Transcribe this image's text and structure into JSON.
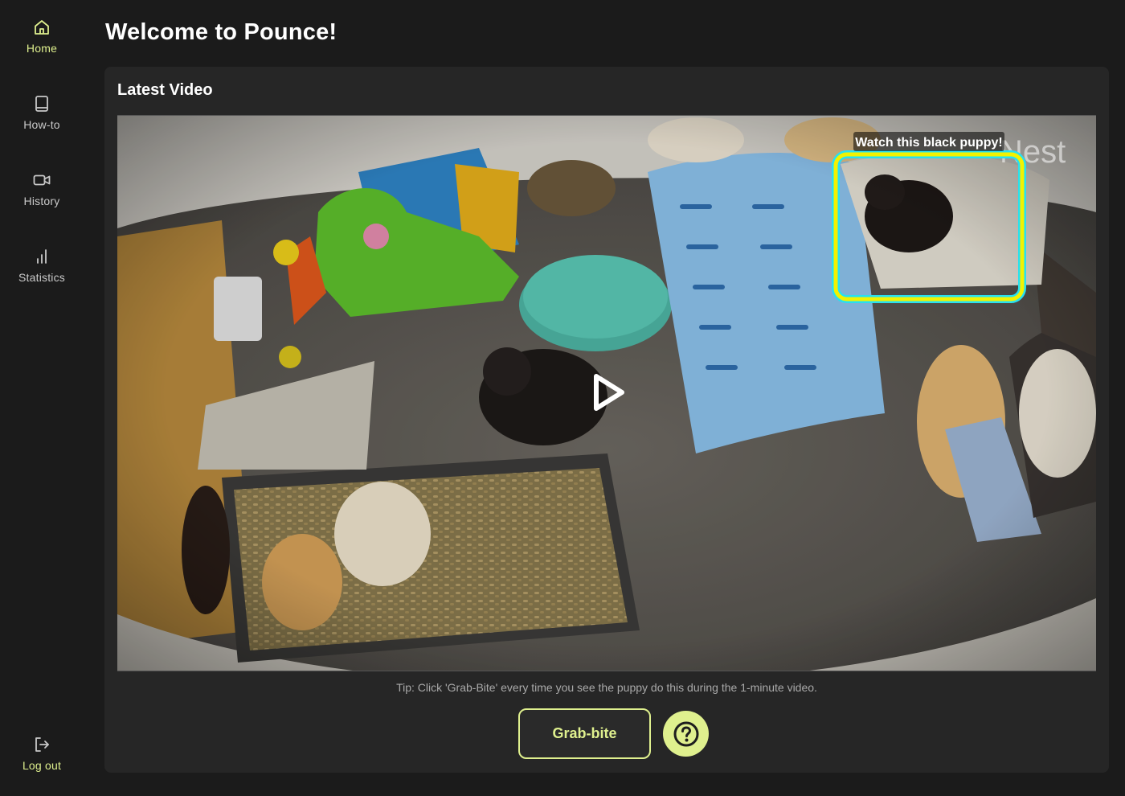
{
  "sidebar": {
    "items": [
      {
        "label": "Home",
        "icon": "home-icon",
        "active": true
      },
      {
        "label": "How-to",
        "icon": "book-icon",
        "active": false
      },
      {
        "label": "History",
        "icon": "video-camera-icon",
        "active": false
      },
      {
        "label": "Statistics",
        "icon": "bar-chart-icon",
        "active": false
      }
    ],
    "logout": {
      "label": "Log out",
      "icon": "logout-icon"
    }
  },
  "header": {
    "title": "Welcome to Pounce!"
  },
  "card": {
    "title": "Latest Video",
    "video": {
      "highlight_caption": "Watch this black puppy!",
      "watermark": "Nest",
      "play_icon": "play-icon"
    },
    "tip": "Tip: Click 'Grab-Bite' every time you see the puppy do this during the 1-minute video.",
    "grab_button_label": "Grab-bite",
    "help_icon": "question-circle-icon"
  },
  "colors": {
    "accent": "#dff08e",
    "background": "#1b1b1b",
    "card": "#262626",
    "highlight_outer": "#27e0f0",
    "highlight_inner": "#f2f200"
  }
}
